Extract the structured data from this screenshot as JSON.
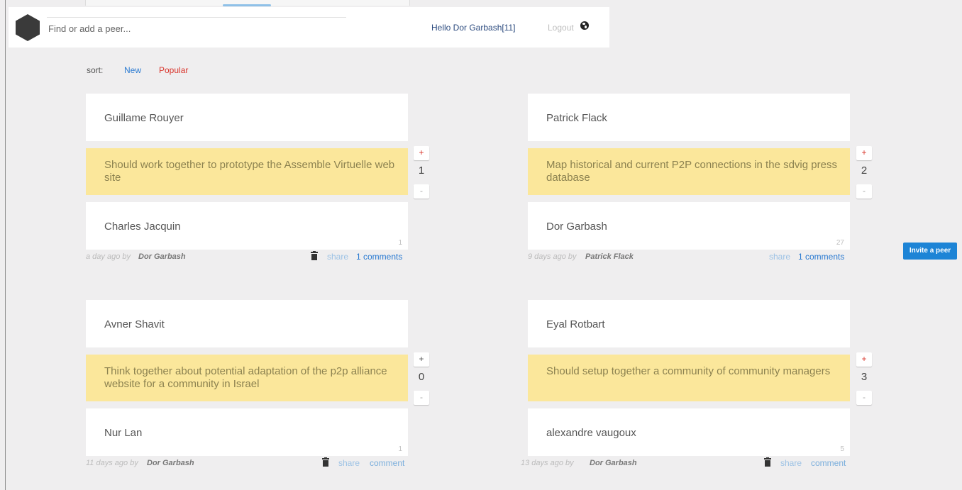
{
  "header": {
    "search_placeholder": "Find or add a peer...",
    "hello": "Hello Dor Garbash[11]",
    "logout": "Logout",
    "globe_icon": "globe-icon"
  },
  "sort": {
    "label": "sort:",
    "new": "New",
    "popular": "Popular"
  },
  "cards": [
    {
      "peer_a": "Guillame Rouyer",
      "goal": "Should work together to prototype the Assemble Virtuelle web site",
      "peer_b": "Charles Jacquin",
      "count": "1",
      "votes": "1",
      "plus": "+",
      "minus": "-",
      "when": "a day ago by",
      "author": "Dor Garbash",
      "share": "share",
      "comments": "1 comments"
    },
    {
      "peer_a": "Patrick Flack",
      "goal": "Map historical and current P2P connections in the sdvig press database",
      "peer_b": "Dor Garbash",
      "count": "27",
      "votes": "2",
      "plus": "+",
      "minus": "-",
      "when": "9 days ago by",
      "author": "Patrick Flack",
      "share": "share",
      "comments": "1 comments"
    },
    {
      "peer_a": "Avner Shavit",
      "goal": "Think together about potential adaptation of the p2p alliance website for a community in Israel",
      "peer_b": "Nur Lan",
      "count": "1",
      "votes": "0",
      "plus": "+",
      "minus": "-",
      "when": "11 days ago by",
      "author": "Dor Garbash",
      "share": "share",
      "comments": "comment"
    },
    {
      "peer_a": "Eyal Rotbart",
      "goal": "Should setup together a community of community managers",
      "peer_b": "alexandre vaugoux",
      "count": "5",
      "votes": "3",
      "plus": "+",
      "minus": "-",
      "when": "13 days ago by",
      "author": "Dor Garbash",
      "share": "share",
      "comments": "comment"
    }
  ],
  "invite_label": "Invite a peer",
  "colors": {
    "accent": "#1d84d6",
    "goal_bg": "#fbe79b",
    "popular": "#d9342b",
    "page_bg": "#efeeef"
  }
}
